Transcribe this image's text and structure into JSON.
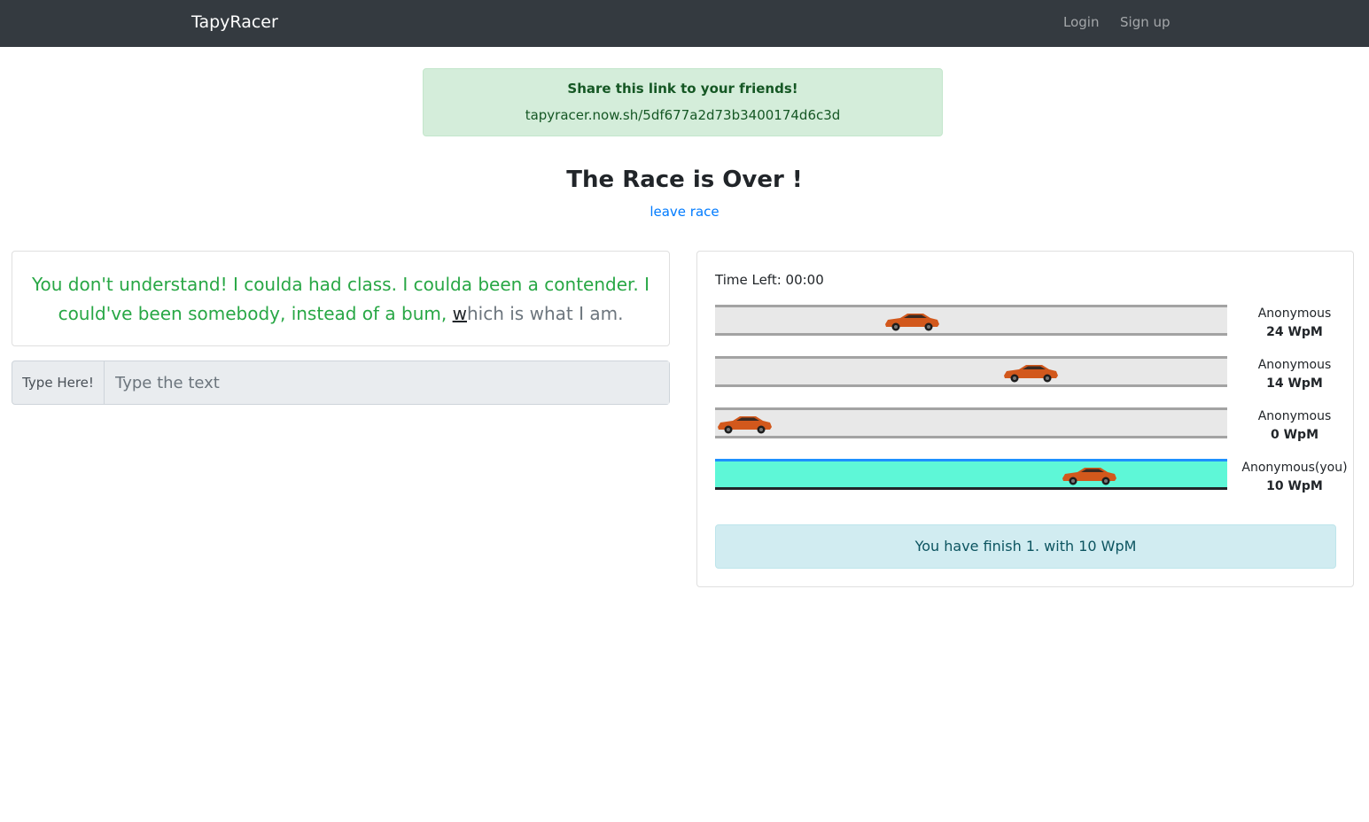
{
  "navbar": {
    "brand": "TapyRacer",
    "login_label": "Login",
    "signup_label": "Sign up"
  },
  "share": {
    "title": "Share this link to your friends!",
    "link": "tapyracer.now.sh/5df677a2d73b3400174d6c3d"
  },
  "race": {
    "heading": "The Race is Over !",
    "leave_label": "leave race"
  },
  "text_panel": {
    "typed": "You don't understand! I coulda had class. I coulda been a contender. I could've been somebody, instead of a bum, ",
    "current_char": "w",
    "remaining": "hich is what I am."
  },
  "input": {
    "prepend_label": "Type Here!",
    "placeholder": "Type the text",
    "value": ""
  },
  "race_panel": {
    "time_left": "Time Left: 00:00",
    "racers": [
      {
        "name": "Anonymous",
        "wpm": "24 WpM",
        "progress": 0.37,
        "is_you": false
      },
      {
        "name": "Anonymous",
        "wpm": "14 WpM",
        "progress": 0.63,
        "is_you": false
      },
      {
        "name": "Anonymous",
        "wpm": "0 WpM",
        "progress": 0.0,
        "is_you": false
      },
      {
        "name": "Anonymous(you)",
        "wpm": "10 WpM",
        "progress": 0.76,
        "is_you": true
      }
    ],
    "result": "You have finish 1. with 10 WpM"
  },
  "colors": {
    "navbar_bg": "#343a40",
    "typed_text": "#28a745",
    "you_track": "#5ef7d7",
    "car_body": "#d2581c"
  },
  "icons": {
    "car": "race-car-icon"
  }
}
